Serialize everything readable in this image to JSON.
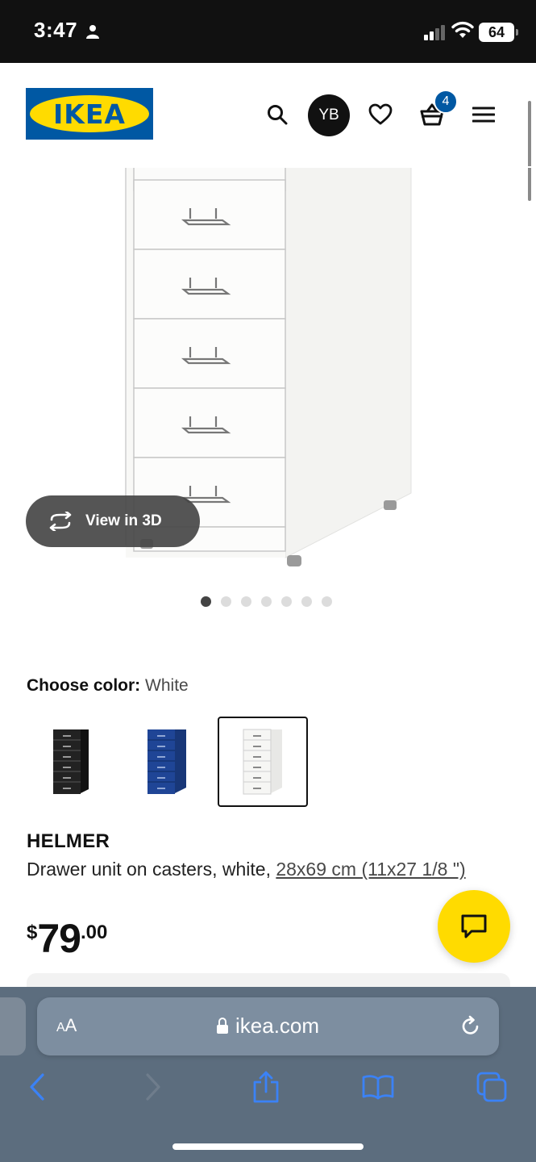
{
  "status_bar": {
    "time": "3:47",
    "battery": "64"
  },
  "header": {
    "logo_text": "IKEA",
    "avatar_initials": "YB",
    "cart_count": "4",
    "colors": {
      "brand_blue": "#0058a3",
      "brand_yellow": "#ffdb00"
    }
  },
  "gallery": {
    "view_3d_label": "View in 3D",
    "image_count": 7,
    "active_index": 0
  },
  "color_chooser": {
    "label": "Choose color:",
    "selected_value": "White",
    "options": [
      {
        "name": "Black",
        "color": "#1e1e1e"
      },
      {
        "name": "Blue",
        "color": "#1c3f8c"
      },
      {
        "name": "White",
        "color": "#f4f4f2"
      }
    ],
    "selected_index": 2
  },
  "product": {
    "name": "HELMER",
    "description": "Drawer unit on casters, white, ",
    "size_link": "28x69 cm (11x27 1/8 \")",
    "price_currency": "$",
    "price_integer": "79",
    "price_decimal": ".00"
  },
  "browser": {
    "text_size_label_small": "A",
    "text_size_label_large": "A",
    "url": "ikea.com",
    "colors": {
      "toolbar": "#5c6d7e",
      "accent": "#3b82f6"
    }
  }
}
